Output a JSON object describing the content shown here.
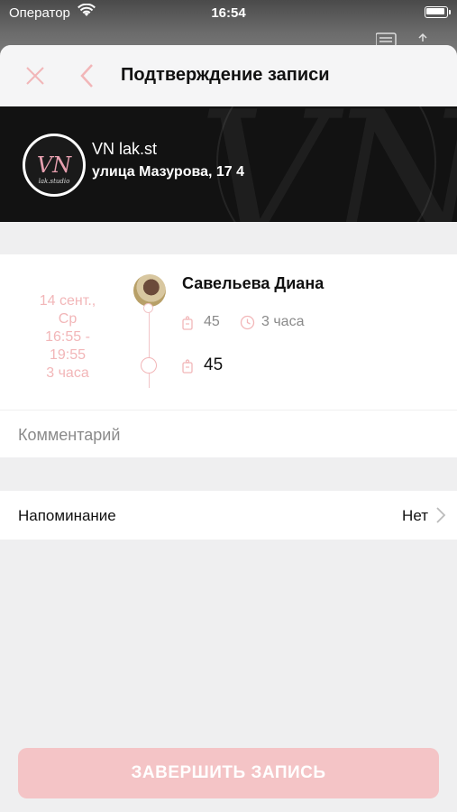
{
  "status_bar": {
    "carrier": "Оператор",
    "time": "16:54"
  },
  "nav": {
    "title": "Подтверждение записи",
    "close_icon": "close-icon",
    "back_icon": "chevron-left-icon"
  },
  "salon": {
    "name": "VN lak.st",
    "address": "улица Мазурова, 17 4"
  },
  "appointment": {
    "date_line1": "14 сент.,",
    "date_line2": "Ср",
    "time_line1": "16:55 -",
    "time_line2": "19:55",
    "duration": "3 часа",
    "master_name": "Савельева Диана",
    "master_price": "45",
    "master_duration": "3 часа",
    "service_price": "45"
  },
  "comment": {
    "placeholder": "Комментарий"
  },
  "reminder": {
    "label": "Напоминание",
    "value": "Нет"
  },
  "finish_button": {
    "label": "ЗАВЕРШИТЬ ЗАПИСЬ"
  },
  "colors": {
    "accent": "#f2b6b8",
    "button_disabled": "#f4c4c6",
    "background": "#efeff0"
  }
}
